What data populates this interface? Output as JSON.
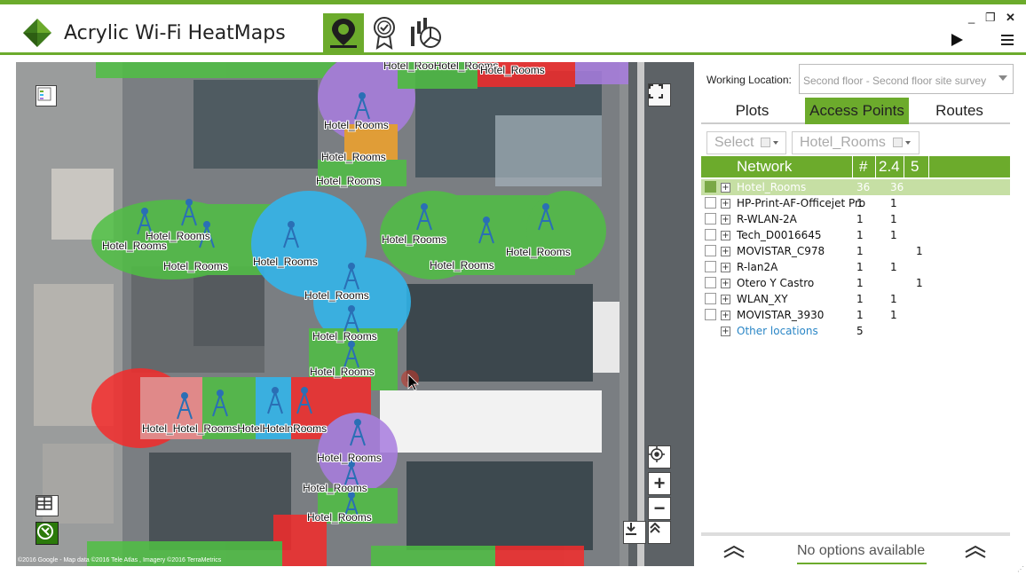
{
  "app": {
    "title": "Acrylic Wi-Fi HeatMaps",
    "brand_color": "#6cab2c",
    "toolbar_icons": [
      "map-pin-icon",
      "certificate-icon",
      "report-chart-icon"
    ],
    "window_controls": [
      "minimize-icon",
      "restore-icon",
      "close-icon"
    ]
  },
  "map": {
    "ap_label": "Hotel_Rooms",
    "overlapped_labels": [
      "Hotel_RooHotel_Rooms",
      "Hotel_Rooms",
      "Hotel_Hotel_RoomsHotelHotelnRooms"
    ],
    "copyright": "©2016 Google - Map data ©2016 Tele Atlas , Imagery ©2016 TerraMetrics",
    "watermark": "Google",
    "controls": [
      "legend-icon",
      "fullscreen-icon",
      "layers-icon",
      "globe-icon",
      "locate-icon",
      "zoom-in-icon",
      "zoom-out-icon",
      "download-icon",
      "collapse-up-icon"
    ],
    "heat_colors": {
      "green": "#4fbf43",
      "blue": "#30b8f0",
      "purple": "#a97de0",
      "red": "#f42b2b",
      "pink": "#f28b8b",
      "orange": "#f2a32a"
    }
  },
  "panel": {
    "working_location_label": "Working Location:",
    "working_location_value": "Second floor - Second floor site survey",
    "tabs": [
      {
        "label": "Plots",
        "active": false
      },
      {
        "label": "Access Points",
        "active": true
      },
      {
        "label": "Routes",
        "active": false
      }
    ],
    "filter_select": "Select",
    "filter_network": "Hotel_Rooms",
    "columns": {
      "network": "Network",
      "count": "#",
      "band24": "2.4",
      "band5": "5"
    },
    "networks": [
      {
        "name": "Hotel_Rooms",
        "count": "36",
        "b24": "36",
        "b5": "",
        "selected": true
      },
      {
        "name": "HP-Print-AF-Officejet Pro",
        "count": "1",
        "b24": "1",
        "b5": ""
      },
      {
        "name": "R-WLAN-2A",
        "count": "1",
        "b24": "1",
        "b5": ""
      },
      {
        "name": "Tech_D0016645",
        "count": "1",
        "b24": "1",
        "b5": ""
      },
      {
        "name": "MOVISTAR_C978",
        "count": "1",
        "b24": "",
        "b5": "1"
      },
      {
        "name": "R-lan2A",
        "count": "1",
        "b24": "1",
        "b5": ""
      },
      {
        "name": "Otero Y Castro",
        "count": "1",
        "b24": "",
        "b5": "1"
      },
      {
        "name": "WLAN_XY",
        "count": "1",
        "b24": "1",
        "b5": ""
      },
      {
        "name": "MOVISTAR_3930",
        "count": "1",
        "b24": "1",
        "b5": ""
      }
    ],
    "other_locations": {
      "name": "Other locations",
      "count": "5"
    },
    "footer_text": "No options available"
  }
}
